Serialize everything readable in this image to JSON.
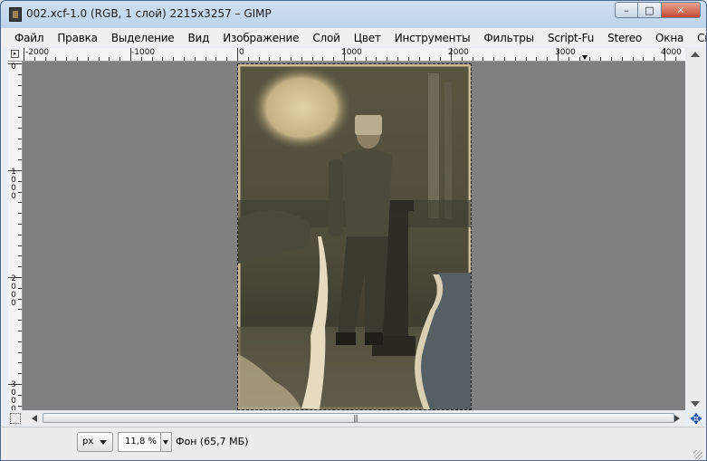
{
  "window": {
    "title": "002.xcf-1.0 (RGB, 1 слой) 2215x3257 – GIMP",
    "buttons": {
      "minimize": "–",
      "maximize": "□",
      "close": "✕"
    }
  },
  "menu": [
    "Файл",
    "Правка",
    "Выделение",
    "Вид",
    "Изображение",
    "Слой",
    "Цвет",
    "Инструменты",
    "Фильтры",
    "Script-Fu",
    "Stereo",
    "Окна",
    "Справка"
  ],
  "rulers": {
    "horizontal_labels": [
      "-2000",
      "-1000",
      "0",
      "1000",
      "2000",
      "3000",
      "4000"
    ],
    "vertical_labels": [
      "0",
      "1000",
      "2000",
      "3000"
    ]
  },
  "canvas": {
    "background_color": "#808080",
    "image_description_icon": "photo-icon"
  },
  "statusbar": {
    "unit": "px",
    "zoom": "11,8 %",
    "layer_info": "Фон (65,7 МБ)"
  },
  "icons": {
    "app": "gimp-icon",
    "navigate": "navigate-icon",
    "quickmask": "quickmask-icon"
  }
}
